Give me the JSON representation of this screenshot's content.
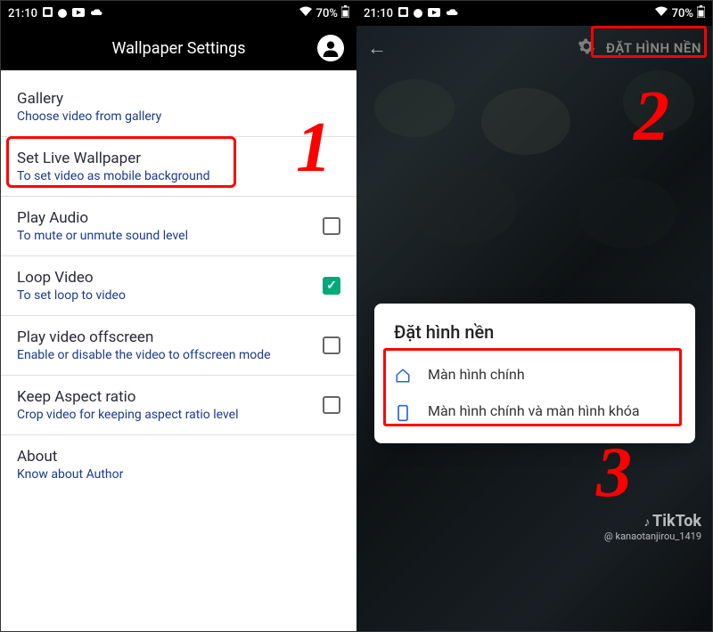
{
  "status": {
    "time": "21:10",
    "battery": "70%"
  },
  "left": {
    "header": "Wallpaper Settings",
    "items": [
      {
        "title": "Gallery",
        "sub": "Choose video from gallery",
        "checkbox": null
      },
      {
        "title": "Set Live Wallpaper",
        "sub": "To set video as mobile background",
        "checkbox": null
      },
      {
        "title": "Play Audio",
        "sub": "To mute or unmute sound level",
        "checkbox": false
      },
      {
        "title": "Loop Video",
        "sub": "To set loop to video",
        "checkbox": true
      },
      {
        "title": "Play video offscreen",
        "sub": "Enable or disable the video to offscreen mode",
        "checkbox": false
      },
      {
        "title": "Keep Aspect ratio",
        "sub": "Crop video for keeping aspect ratio level",
        "checkbox": false
      },
      {
        "title": "About",
        "sub": "Know about Author",
        "checkbox": null
      }
    ]
  },
  "right": {
    "set_button": "ĐẶT HÌNH NỀN",
    "dialog_title": "Đặt hình nền",
    "dialog_option1": "Màn hình chính",
    "dialog_option2": "Màn hình chính và màn hình khóa"
  },
  "tiktok": {
    "brand": "TikTok",
    "user": "@ kanaotanjirou_1419"
  },
  "steps": {
    "one": "1",
    "two": "2",
    "three": "3"
  }
}
